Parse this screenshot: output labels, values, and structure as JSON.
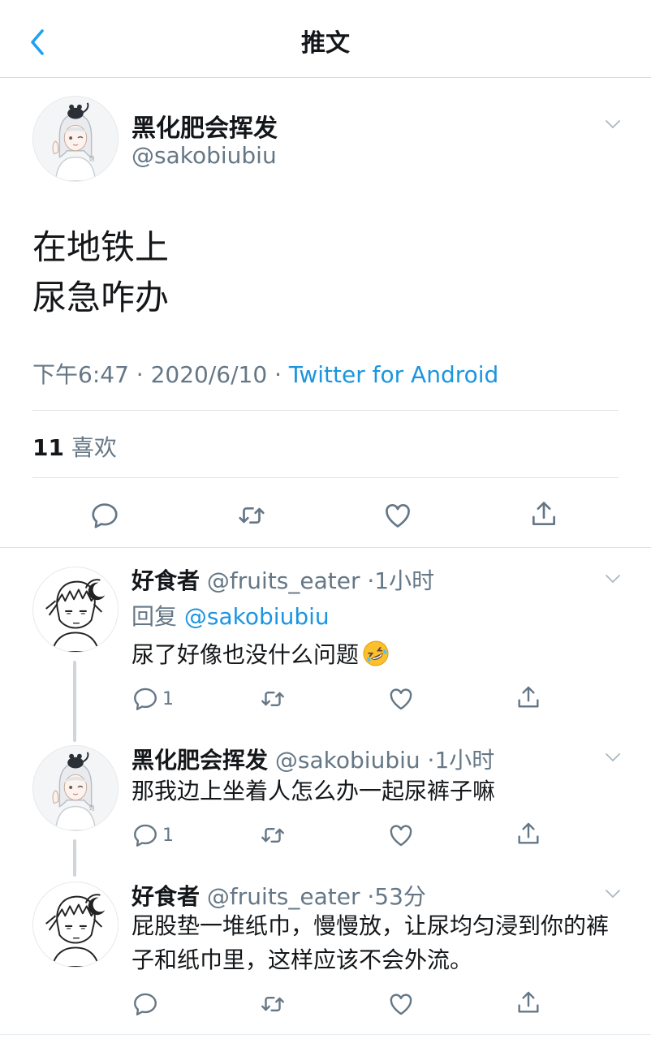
{
  "header": {
    "title": "推文"
  },
  "tweet": {
    "name": "黑化肥会挥发",
    "handle": "@sakobiubiu",
    "lines": [
      "在地铁上",
      "尿急咋办"
    ],
    "time": "下午6:47",
    "date": "2020/6/10",
    "sep": "·",
    "source": "Twitter for Android",
    "likes_count": "11",
    "likes_label": "喜欢"
  },
  "replies": [
    {
      "name": "好食者",
      "handle": "@fruits_eater",
      "sep": "·",
      "time": "1小时",
      "reply_label": "回复",
      "reply_to": "@sakobiubiu",
      "text": "尿了好像也没什么问题",
      "emoji": "rofl-emoji",
      "reply_count": "1"
    },
    {
      "name": "黑化肥会挥发",
      "handle": "@sakobiubiu",
      "sep": "·",
      "time": "1小时",
      "text": "那我边上坐着人怎么办一起尿裤子嘛",
      "reply_count": "1"
    },
    {
      "name": "好食者",
      "handle": "@fruits_eater",
      "sep": "·",
      "time": "53分",
      "text": "屁股垫一堆纸巾，慢慢放，让尿均匀浸到你的裤子和纸巾里，这样应该不会外流。",
      "reply_count": ""
    }
  ],
  "colors": {
    "accent": "#1b95e0",
    "muted": "#657786",
    "text": "#14171a",
    "divider": "#dfe3e6"
  },
  "icons": [
    "back-icon",
    "chevron-down-icon",
    "reply-icon",
    "retweet-icon",
    "like-icon",
    "share-icon"
  ]
}
